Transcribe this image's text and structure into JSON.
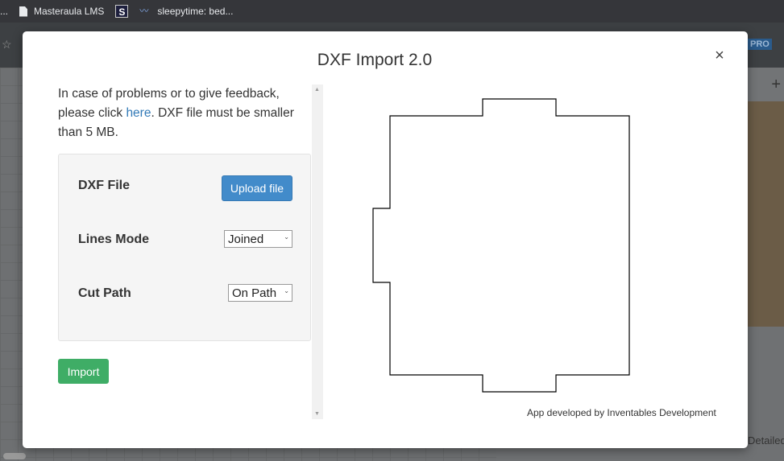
{
  "bookmarks_bar": {
    "ellipsis": "...",
    "items": [
      {
        "label": "Masteraula LMS",
        "icon": "document-icon"
      },
      {
        "label": "",
        "icon": "s-logo-icon",
        "glyph": "S"
      },
      {
        "label": "sleepytime: bed...",
        "icon": "wave-icon"
      }
    ]
  },
  "background_app": {
    "pro_badge": "PRO",
    "partial_text": "Detailed",
    "plus_tab": "+"
  },
  "modal": {
    "title": "DXF Import 2.0",
    "close_glyph": "×",
    "intro_before": "In case of problems or to give feedback, please click ",
    "intro_link": "here",
    "intro_after": ". DXF file must be smaller than 5 MB.",
    "form": {
      "dxf_file_label": "DXF File",
      "upload_label": "Upload file",
      "lines_mode_label": "Lines Mode",
      "lines_mode_value": "Joined",
      "cut_path_label": "Cut Path",
      "cut_path_value": "On Path"
    },
    "import_label": "Import",
    "credit": "App developed by Inventables Development"
  },
  "colors": {
    "upload_button": "#428bca",
    "import_button": "#3fad66",
    "link": "#337ab7"
  }
}
